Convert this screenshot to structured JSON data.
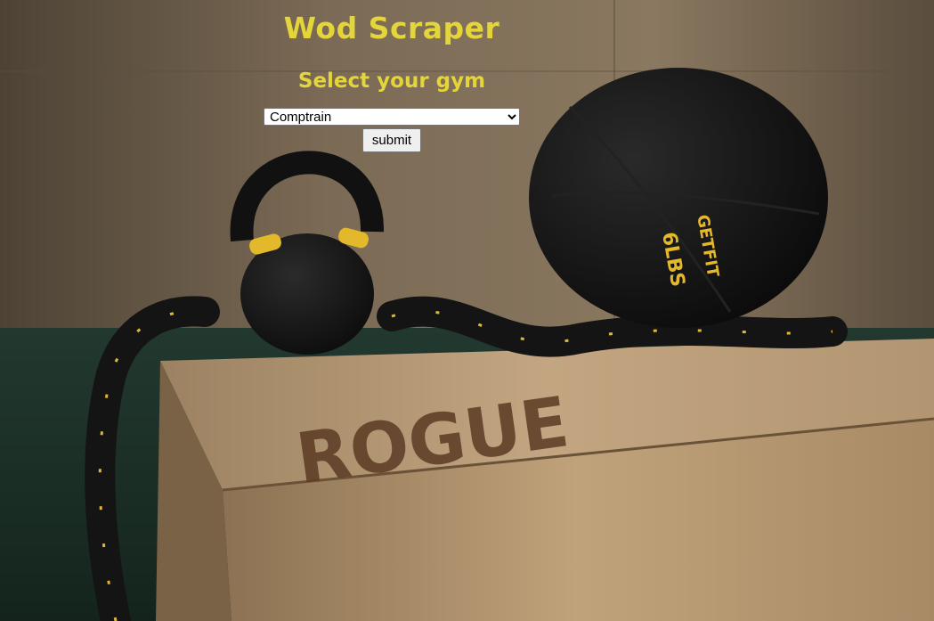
{
  "page": {
    "title": "Wod Scraper",
    "subtitle": "Select your gym"
  },
  "form": {
    "gym_select": {
      "selected": "Comptrain",
      "options": [
        "Comptrain"
      ]
    },
    "submit_label": "submit"
  },
  "background": {
    "wall_color": "#6f5f4c",
    "floor_color": "#1f3a32",
    "box_color": "#b89a72",
    "equipment_color": "#141414",
    "accent_color": "#e3b82a",
    "box_text": "ROGUE",
    "ball_text": "6LBS",
    "ball_brand_text": "GETFIT"
  }
}
